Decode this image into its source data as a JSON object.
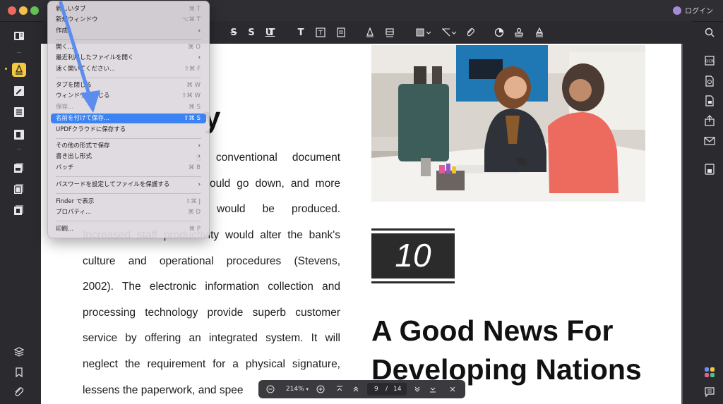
{
  "window": {
    "login_label": "ログイン"
  },
  "menu": {
    "items": [
      {
        "label": "新しいタブ",
        "shortcut": "⌘ T"
      },
      {
        "label": "新規ウィンドウ",
        "shortcut": "⌥⌘ T"
      },
      {
        "label": "作成",
        "submenu": true
      },
      {
        "label": "開く...",
        "shortcut": "⌘ O"
      },
      {
        "label": "最近利用したファイルを開く",
        "submenu": true
      },
      {
        "label": "速く開いてください...",
        "shortcut": "⇧⌘ F"
      },
      {
        "label": "タブを閉じる",
        "shortcut": "⌘ W"
      },
      {
        "label": "ウィンドウを閉じる",
        "shortcut": "⇧⌘ W"
      },
      {
        "label": "保存...",
        "shortcut": "⌘ S",
        "disabled": true
      },
      {
        "label": "名前を付けて保存...",
        "shortcut": "⇧⌘ S",
        "highlighted": true
      },
      {
        "label": "UPDFクラウドに保存する"
      },
      {
        "label": "その他の形式で保存",
        "submenu": true
      },
      {
        "label": "書き出し形式",
        "submenu": true
      },
      {
        "label": "バッチ",
        "shortcut": "⌘ B"
      },
      {
        "label": "パスワードを設定してファイルを保護する",
        "submenu": true
      },
      {
        "label": "Finder で表示",
        "shortcut": "⇧⌘ J"
      },
      {
        "label": "プロパティ...",
        "shortcut": "⌘ D"
      },
      {
        "label": "印刷...",
        "shortcut": "⌘ P"
      }
    ]
  },
  "document": {
    "partial_heading": "y",
    "body_lines": [
      "s conventional document",
      "ould go down, and more",
      "would be produced.",
      "Increased staff productivity would alter the bank's",
      "culture and operational procedures (Stevens,",
      "2002). The electronic information collection and",
      "processing technology provide superb customer",
      "service by offering an integrated system. It will",
      "neglect the requirement for a physical signature,",
      "lessens the paperwork, and spee"
    ],
    "badge_number": "10",
    "heading_line1": "A Good News For",
    "heading_line2": "Developing Nations"
  },
  "bottombar": {
    "zoom": "214%",
    "current_page": "9",
    "separator": "/",
    "total_pages": "14"
  },
  "colors": {
    "accent": "#3b82f2",
    "badge_bg": "#2b2b2b",
    "chrome": "#2b2a2f"
  }
}
